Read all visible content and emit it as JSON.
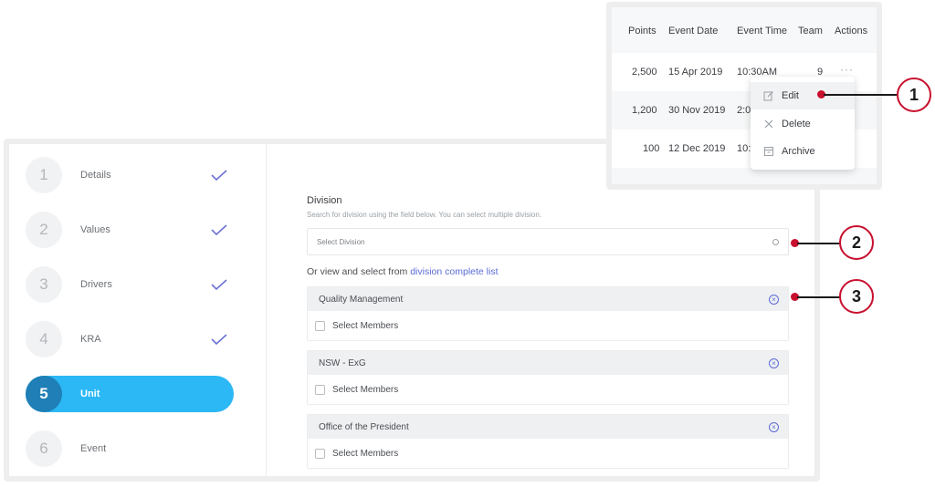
{
  "steps": [
    {
      "num": "1",
      "label": "Details",
      "done": true
    },
    {
      "num": "2",
      "label": "Values",
      "done": true
    },
    {
      "num": "3",
      "label": "Drivers",
      "done": true
    },
    {
      "num": "4",
      "label": "KRA",
      "done": true
    },
    {
      "num": "5",
      "label": "Unit",
      "active": true
    },
    {
      "num": "6",
      "label": "Event"
    }
  ],
  "division": {
    "title": "Division",
    "help": "Search for division using the field below. You can select multiple division.",
    "placeholder": "Select Division",
    "or_text": "Or view and select from ",
    "link_text": "division complete list"
  },
  "units": [
    {
      "name": "Quality Management",
      "select_label": "Select Members"
    },
    {
      "name": "NSW - ExG",
      "select_label": "Select Members"
    },
    {
      "name": "Office of the President",
      "select_label": "Select Members"
    }
  ],
  "table": {
    "headers": [
      "Points",
      "Event Date",
      "Event Time",
      "Team",
      "Actions"
    ],
    "rows": [
      {
        "points": "2,500",
        "date": "15 Apr 2019",
        "time": "10:30AM",
        "team": "9"
      },
      {
        "points": "1,200",
        "date": "30 Nov 2019",
        "time": "2:0"
      },
      {
        "points": "100",
        "date": "12 Dec 2019",
        "time": "10:"
      }
    ]
  },
  "menu": [
    "Edit",
    "Delete",
    "Archive"
  ],
  "callouts": [
    "1",
    "2",
    "3"
  ],
  "colors": {
    "accent": "#2bb8f5",
    "check": "#6b72d4",
    "callout": "#c8102e",
    "link": "#5b6bd6"
  }
}
